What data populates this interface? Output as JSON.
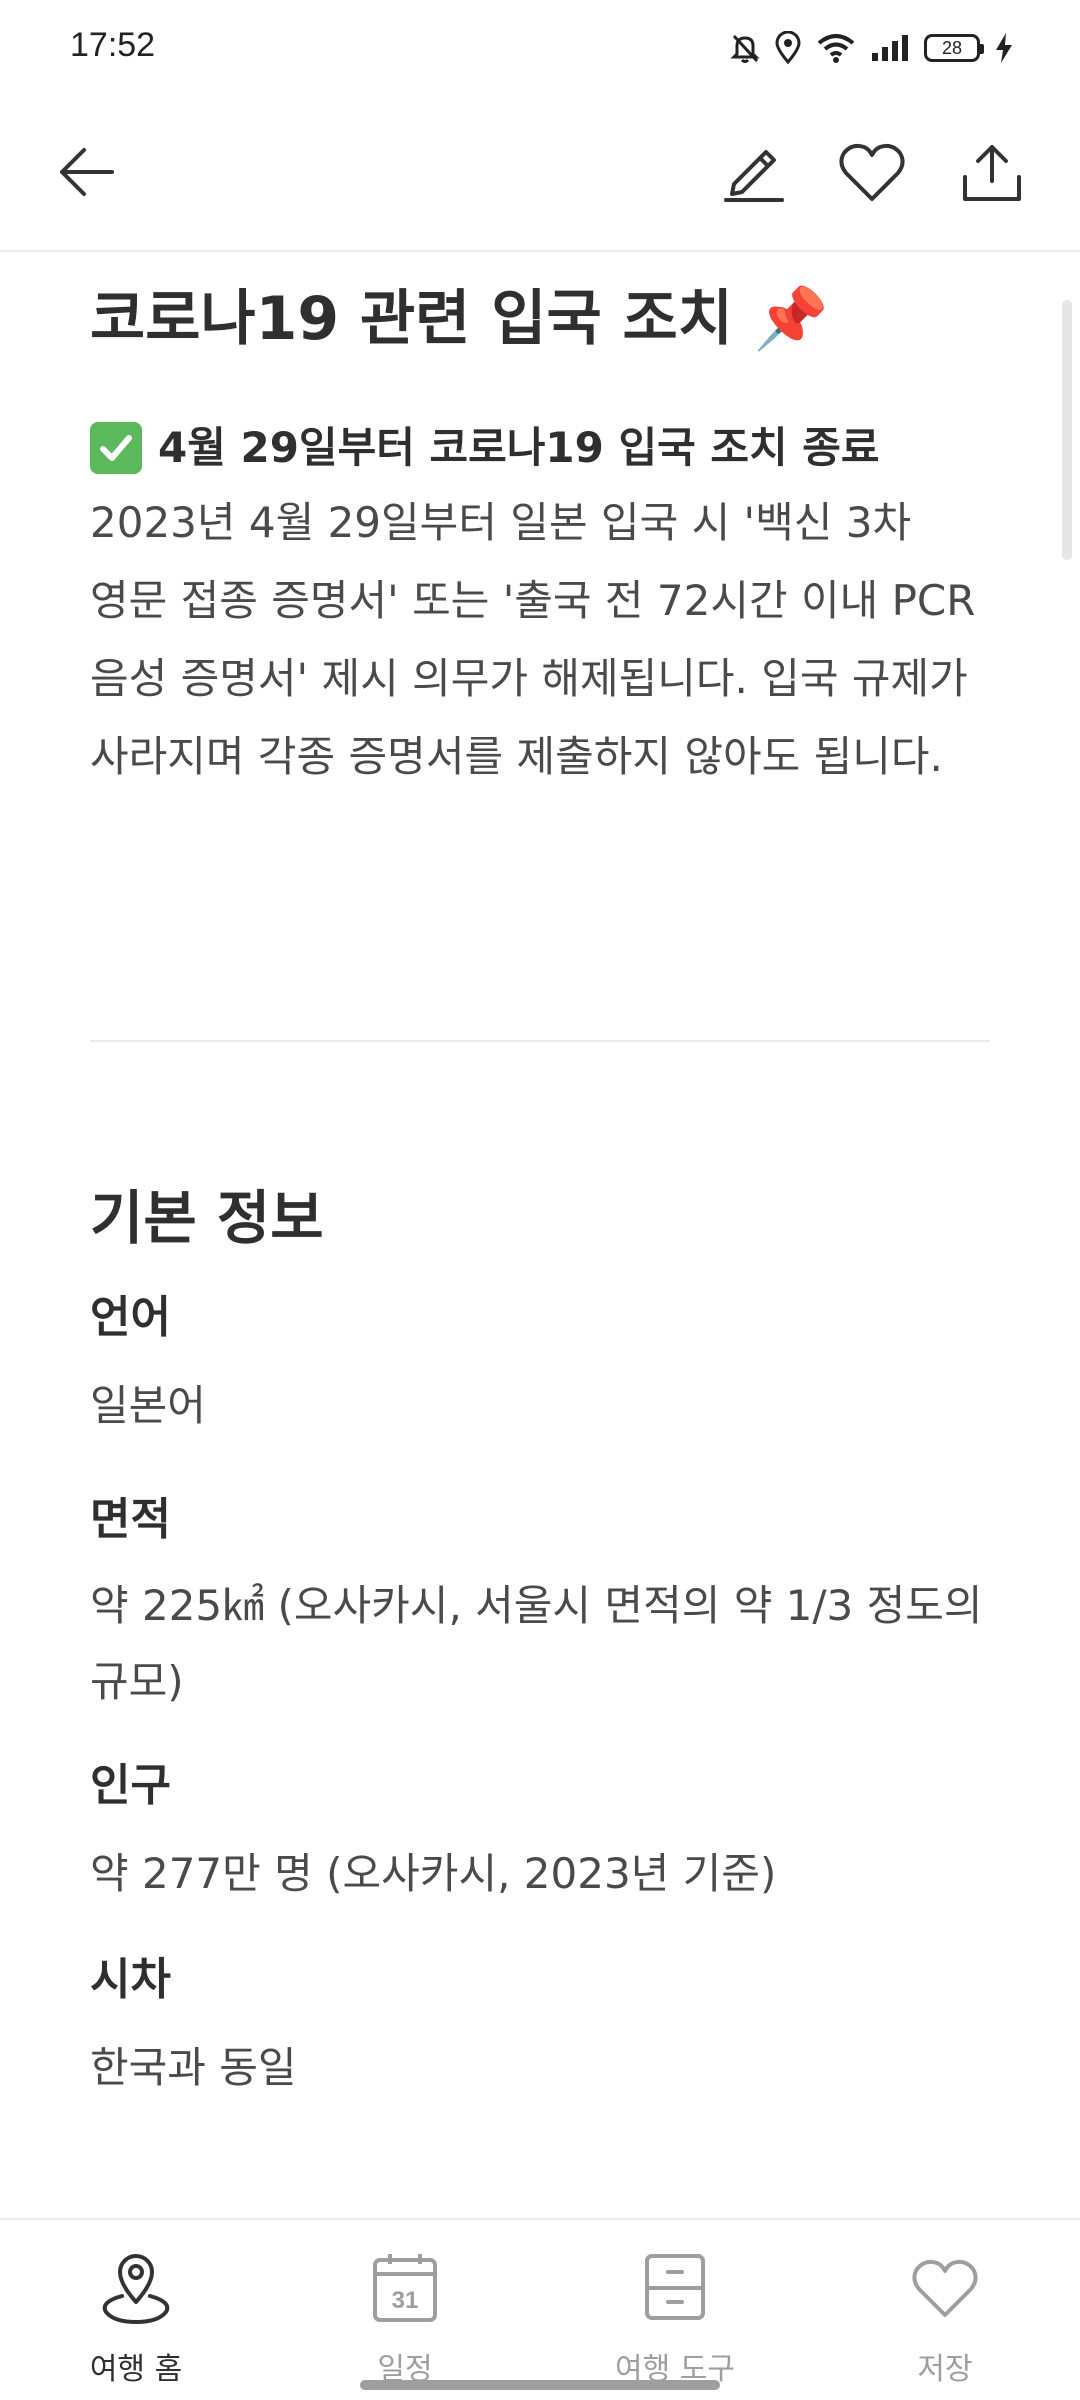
{
  "status_bar": {
    "time": "17:52",
    "battery": "28"
  },
  "app_bar": {
    "back_icon": "arrow-left-icon",
    "edit_icon": "pencil-icon",
    "favorite_icon": "heart-icon",
    "share_icon": "share-upload-icon"
  },
  "covid_section": {
    "title": "코로나19 관련 입국 조치 📌",
    "headline": "4월 29일부터 코로나19 입국 조치 종료",
    "body": "2023년 4월 29일부터 일본 입국 시 '백신 3차 영문 접종 증명서' 또는 '출국 전 72시간 이내 PCR 음성 증명서' 제시 의무가 해제됩니다. 입국 규제가 사라지며 각종 증명서를 제출하지 않아도 됩니다."
  },
  "basic_info": {
    "title": "기본 정보",
    "items": [
      {
        "label": "언어",
        "value": "일본어"
      },
      {
        "label": "면적",
        "value": "약 225㎢ (오사카시, 서울시 면적의 약 1/3 정도의 규모)"
      },
      {
        "label": "인구",
        "value": "약 277만 명 (오사카시, 2023년 기준)"
      },
      {
        "label": "시차",
        "value": "한국과 동일"
      }
    ]
  },
  "bottom_nav": {
    "items": [
      {
        "label": "여행 홈",
        "icon": "map-pin-icon",
        "active": true
      },
      {
        "label": "일정",
        "icon": "calendar-icon",
        "calendar_day": "31"
      },
      {
        "label": "여행 도구",
        "icon": "luggage-icon"
      },
      {
        "label": "저장",
        "icon": "heart-icon"
      }
    ]
  },
  "colors": {
    "text_primary": "#2f2f2f",
    "text_secondary": "#4a4a4a",
    "nav_inactive": "#9e9e9e",
    "check_green": "#5cb85c"
  }
}
